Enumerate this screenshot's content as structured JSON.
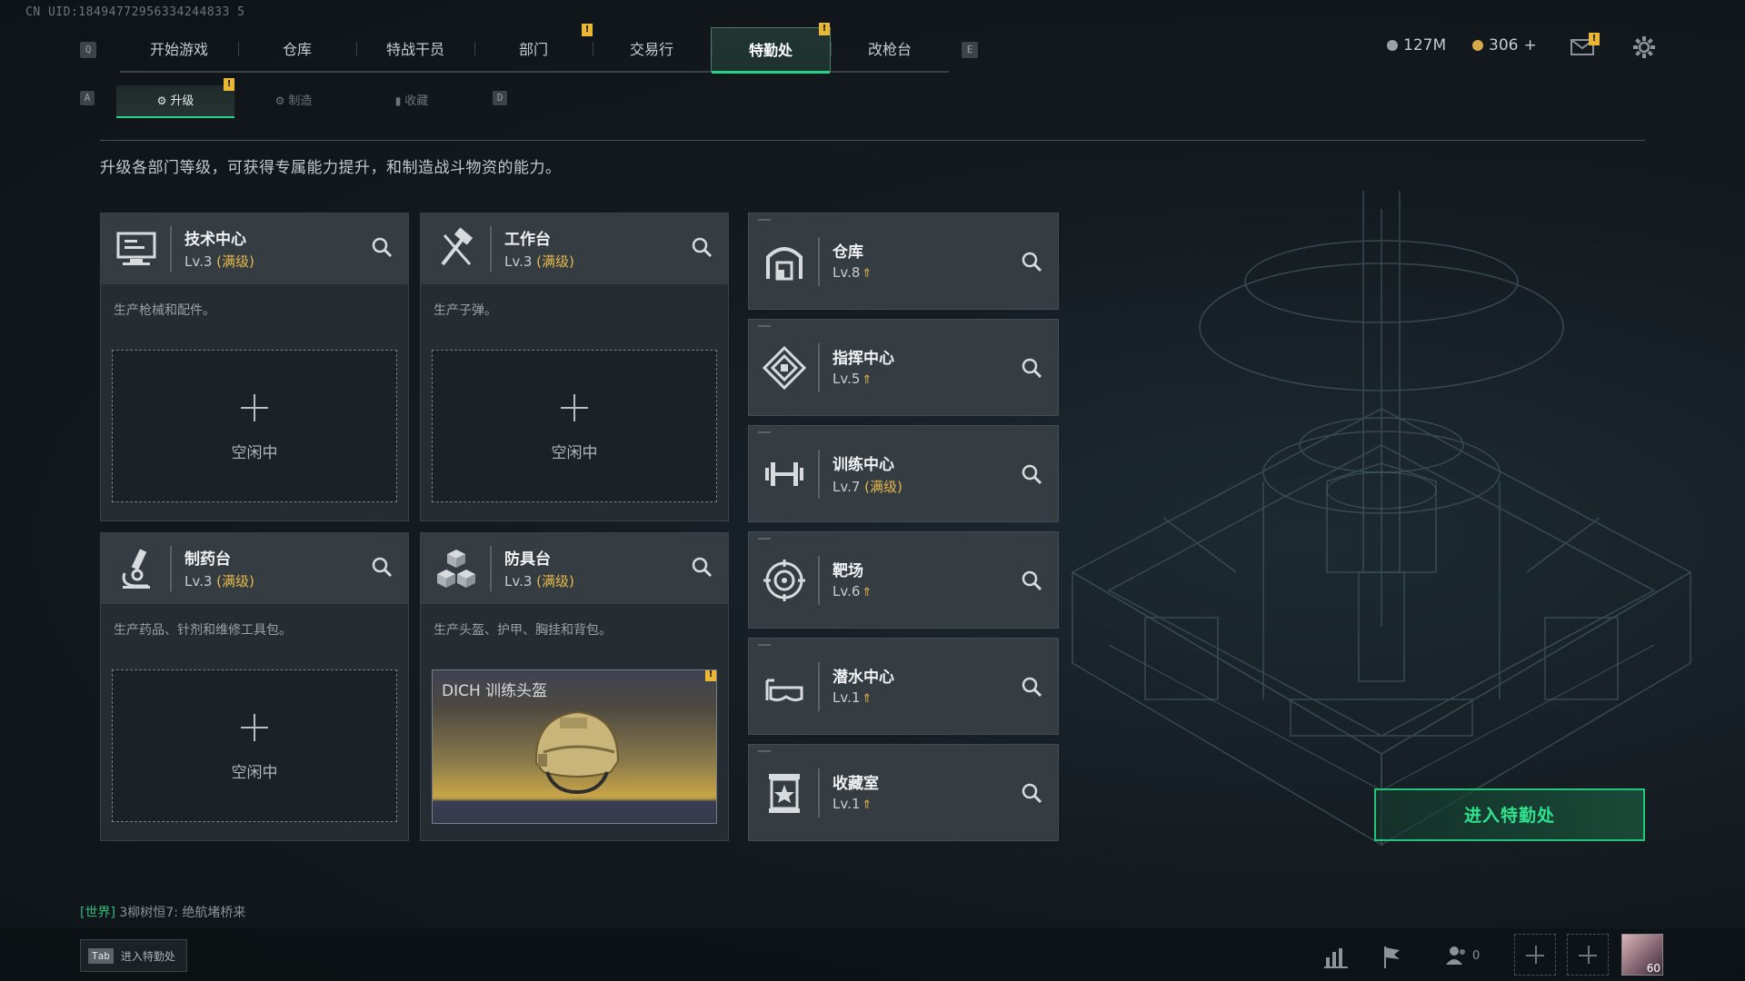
{
  "uid": "CN UID:18494772956334244833 5",
  "nav": {
    "prev_key": "Q",
    "next_key": "E",
    "tabs": [
      "开始游戏",
      "仓库",
      "特战干员",
      "部门",
      "交易行",
      "特勤处",
      "改枪台"
    ],
    "active": "特勤处"
  },
  "currency": {
    "money": "127M",
    "coins": "306"
  },
  "subnav": {
    "prev_key": "A",
    "next_key": "D",
    "tabs": [
      "升级",
      "制造",
      "收藏"
    ],
    "active": "升级"
  },
  "description": "升级各部门等级，可获得专属能力提升，和制造战斗物资的能力。",
  "production": [
    {
      "name": "技术中心",
      "level": "Lv.3",
      "max": "(满级)",
      "desc": "生产枪械和配件。",
      "slot": "空闲中",
      "icon": "monitor-icon"
    },
    {
      "name": "工作台",
      "level": "Lv.3",
      "max": "(满级)",
      "desc": "生产子弹。",
      "slot": "空闲中",
      "icon": "hammer-icon"
    },
    {
      "name": "制药台",
      "level": "Lv.3",
      "max": "(满级)",
      "desc": "生产药品、针剂和维修工具包。",
      "slot": "空闲中",
      "icon": "microscope-icon"
    },
    {
      "name": "防具台",
      "level": "Lv.3",
      "max": "(满级)",
      "desc": "生产头盔、护甲、胸挂和背包。",
      "item": "DICH 训练头盔",
      "icon": "cubes-icon"
    }
  ],
  "departments": [
    {
      "name": "仓库",
      "level": "Lv.8",
      "upgrade": "⇑",
      "icon": "warehouse-icon"
    },
    {
      "name": "指挥中心",
      "level": "Lv.5",
      "upgrade": "⇑",
      "icon": "command-icon"
    },
    {
      "name": "训练中心",
      "level": "Lv.7",
      "max": "(满级)",
      "icon": "dumbbell-icon"
    },
    {
      "name": "靶场",
      "level": "Lv.6",
      "upgrade": "⇑",
      "icon": "target-icon"
    },
    {
      "name": "潜水中心",
      "level": "Lv.1",
      "upgrade": "⇑",
      "icon": "goggles-icon"
    },
    {
      "name": "收藏室",
      "level": "Lv.1",
      "upgrade": "⇑",
      "icon": "collection-icon"
    }
  ],
  "enter_button": "进入特勤处",
  "chat": {
    "channel": "[世界]",
    "message": "3柳树恒7: 绝航堵桥来"
  },
  "tab_hint": {
    "key": "Tab",
    "label": "进入特勤处"
  },
  "friends_count": "0",
  "avatar_level": "60",
  "colors": {
    "accent": "#27d28a",
    "max_level": "#e6b94a",
    "badge": "#e9b733"
  }
}
